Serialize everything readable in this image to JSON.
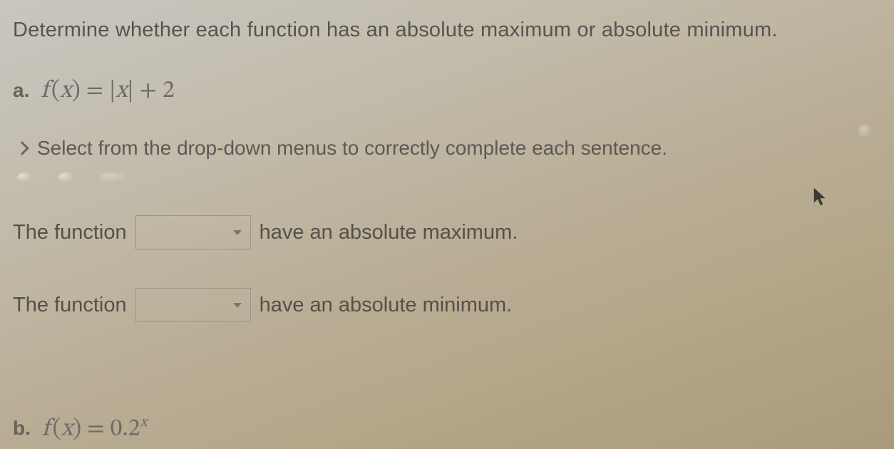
{
  "prompt": "Determine whether each function has an absolute maximum or absolute minimum.",
  "partA": {
    "label": "a.",
    "function_display": "f (x) = |x| + 2"
  },
  "instruction": "Select from the drop-down menus to correctly complete each sentence.",
  "sentence1": {
    "prefix": "The function",
    "dropdown_value": "",
    "suffix": "have an absolute maximum."
  },
  "sentence2": {
    "prefix": "The function",
    "dropdown_value": "",
    "suffix": "have an absolute minimum."
  },
  "partB": {
    "label": "b.",
    "function_display": "f (x) = 0.2^x"
  }
}
